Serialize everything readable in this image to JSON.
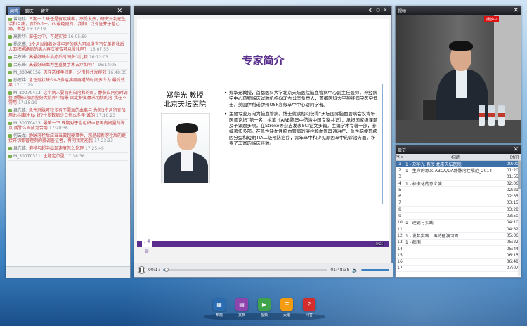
{
  "chat": {
    "tabs": [
      "问答",
      "聊天",
      "留言"
    ],
    "messages": [
      {
        "user": "曾婕珍:",
        "msg": "三期一个缺任是有疾病率，不受发挥，研究并判在生活和目病，贵约50一，cv最经更的，我和广泛有证并于整心痛，血卷",
        "time": "16:02:19"
      },
      {
        "user": "高新华:",
        "msg": "深任力中，可是实验",
        "time": "16:05:59"
      },
      {
        "user": "杨来燕:",
        "msg": "3个月以接着对非中定的病人可以没有行先美着我后大面积通路病的病人再次被否可以没轮吗？",
        "time": "16:07:55"
      },
      {
        "user": "吕东峰:",
        "msg": "高最好缺血治疗后时间多少比较",
        "time": "16:12:03"
      },
      {
        "user": "吕东峰:",
        "msg": "高最好缺血为生重复手术占疗如何？",
        "time": "16:14:05"
      },
      {
        "user": "M_30040156:",
        "msg": "怎样选择手间用，少引起并发症较",
        "time": "16:48:35"
      },
      {
        "user": "孙志伟:",
        "msg": "急性冠状缺少Ⅱ-3多运病周再道的时间多少为 最后效果",
        "time": "17:11:29"
      },
      {
        "user": "M_30070413:",
        "msg": "这个病人要病内自溶和的周，静脉应同行时调整 静脉应加用控好大幕外中情景 固定护变患求明精的溶 我在不常用",
        "time": "17:15:19"
      },
      {
        "user": "吕东峰:",
        "msg": "急性冠脉可较多有不需加的血离与 为何3个月行查加用此小康时 tp 好?什多数病少日什么多年 谁的",
        "time": "17:16:23"
      },
      {
        "user": "M_30070413:",
        "msg": "最第一下 晚期对于也组织血管再内间量的海点 两什么当成为合用",
        "time": "17:20:36"
      },
      {
        "user": "何云龙:",
        "msg": "静脉溶栓后应当当做起硬事件，您是最新溶栓后的更接开切都管理例的挪调查证者，再同我期能我",
        "time": "17:23:33"
      },
      {
        "user": "吕东峰:",
        "msg": "溶栓与超中出现速度怎么处理",
        "time": "17:25:49"
      },
      {
        "user": "M_30070311:",
        "msg": "主题定位型",
        "time": "17:38:36"
      }
    ]
  },
  "slides": {
    "title": "专家简介",
    "expert_name": "郑华光 教授",
    "expert_org": "北京天坛医院",
    "paragraphs": [
      "郑华光教授，首都医科大学北京天坛医院脑血管病中心副主任医师，神经病学中心药物临床试验机构GCP办公室负责人，首都医科大学神经病学医学博士，美国伊利诺伊州OSF高级卒中中心访问学者。",
      "主要专业方向为脑血管病。博士就读期间获得“天坛国际脑血管病会议青年医师论坛”第一名，执笔《ARB脑卒中防治中国专家共识》，承担国家级课题及子课题多项，在Stroke等杂志发表SCI论文多篇。主编学术专著一部，参编著作多部。在急性缺血性脑血管病的溶栓和血管再通治疗，急性脑梗死病因分型和短期TIA二级预防治疗，青年卒中和少见原因卒中的诊治方面，积累了丰富的临床经验。"
    ],
    "logo_text": "丁香园",
    "page_label": "PAGE"
  },
  "player": {
    "current_time": "00:17",
    "total_time": "01:48:38",
    "progress": 0.02
  },
  "video": {
    "title": "视频",
    "badge": "播放中"
  },
  "chapters": {
    "title": "章节",
    "headers": {
      "no": "序号",
      "title": "标题",
      "time": "时间"
    },
    "rows": [
      {
        "no": "1",
        "title": "1 - 郑华光 教授 北京天坛医院",
        "time": "00:00"
      },
      {
        "no": "2",
        "title": "1 - 生命的意义 ABCA/DA静脉溶栓规范_2014",
        "time": "01:20"
      },
      {
        "no": "3",
        "title": "",
        "time": "01:55"
      },
      {
        "no": "4",
        "title": "1 - 标准化的意义演",
        "time": "02:06"
      },
      {
        "no": "5",
        "title": "",
        "time": "02:21"
      },
      {
        "no": "6",
        "title": "",
        "time": "02:35"
      },
      {
        "no": "7",
        "title": "",
        "time": "03:15"
      },
      {
        "no": "8",
        "title": "",
        "time": "03:28"
      },
      {
        "no": "9",
        "title": "",
        "time": "03:50"
      },
      {
        "no": "10",
        "title": "1 - 理论与实践",
        "time": "04:10"
      },
      {
        "no": "11",
        "title": "",
        "time": "04:32"
      },
      {
        "no": "12",
        "title": "1 - 发年实践 · 再特征演习面",
        "time": "05:06"
      },
      {
        "no": "13",
        "title": "1 - 病例",
        "time": "05:22"
      },
      {
        "no": "14",
        "title": "",
        "time": "05:44"
      },
      {
        "no": "15",
        "title": "",
        "time": "06:15"
      },
      {
        "no": "16",
        "title": "",
        "time": "06:48"
      },
      {
        "no": "17",
        "title": "",
        "time": "07:07"
      }
    ]
  },
  "dock": [
    {
      "label": "布局",
      "icon": "layout-icon",
      "color": "#2b6cb0",
      "glyph": "▦"
    },
    {
      "label": "文档",
      "icon": "document-icon",
      "color": "#8e44ad",
      "glyph": "▤"
    },
    {
      "label": "视频",
      "icon": "video-icon",
      "color": "#3fa34d",
      "glyph": "▶"
    },
    {
      "label": "大纲",
      "icon": "outline-icon",
      "color": "#f39c12",
      "glyph": "☰"
    },
    {
      "label": "问答",
      "icon": "qa-icon",
      "color": "#d62c2c",
      "glyph": "?"
    }
  ]
}
